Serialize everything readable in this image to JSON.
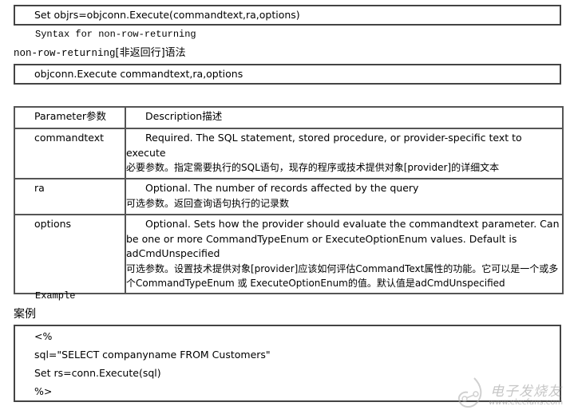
{
  "syntax_box": {
    "line": "Set objrs=objconn.Execute(commandtext,ra,options)"
  },
  "syntax_non_row": {
    "label_en": "Syntax for non-row-returning",
    "label_mixed_prefix": "non-row-returning",
    "label_mixed_cn": "[非返回行]语法"
  },
  "non_row_box": {
    "line": "objconn.Execute commandtext,ra,options"
  },
  "params_table": {
    "headers": [
      "Parameter参数",
      "Description描述"
    ],
    "rows": [
      {
        "name": "commandtext",
        "desc_en_first": "Required. The SQL statement, stored procedure, or provider-specific text to",
        "desc_en_rest": "execute",
        "desc_cn": "必要参数。指定需要执行的SQL语句，现存的程序或技术提供对象[provider]的详细文本"
      },
      {
        "name": "ra",
        "desc_en_first": "Optional. The number of records affected by the query",
        "desc_en_rest": "",
        "desc_cn": "可选参数。返回查询语句执行的记录数"
      },
      {
        "name": "options",
        "desc_en_first": "Optional. Sets how the provider should evaluate the commandtext parameter. Can",
        "desc_en_rest": "be one or more CommandTypeEnum or ExecuteOptionEnum values. Default is adCmdUnspecified",
        "desc_cn": "可选参数。设置技术提供对象[provider]应该如何评估CommandText属性的功能。它可以是一个或多个CommandTypeEnum 或 ExecuteOptionEnum的值。默认值是adCmdUnspecified"
      }
    ]
  },
  "example": {
    "label_en": "Example",
    "label_cn": "案例",
    "code_lines": [
      "<%",
      "sql=\"SELECT companyname FROM Customers\"",
      "Set rs=conn.Execute(sql)",
      "%>"
    ]
  },
  "watermark": {
    "brand_cn": "电子发烧友",
    "url": "www.elecfans.com"
  }
}
